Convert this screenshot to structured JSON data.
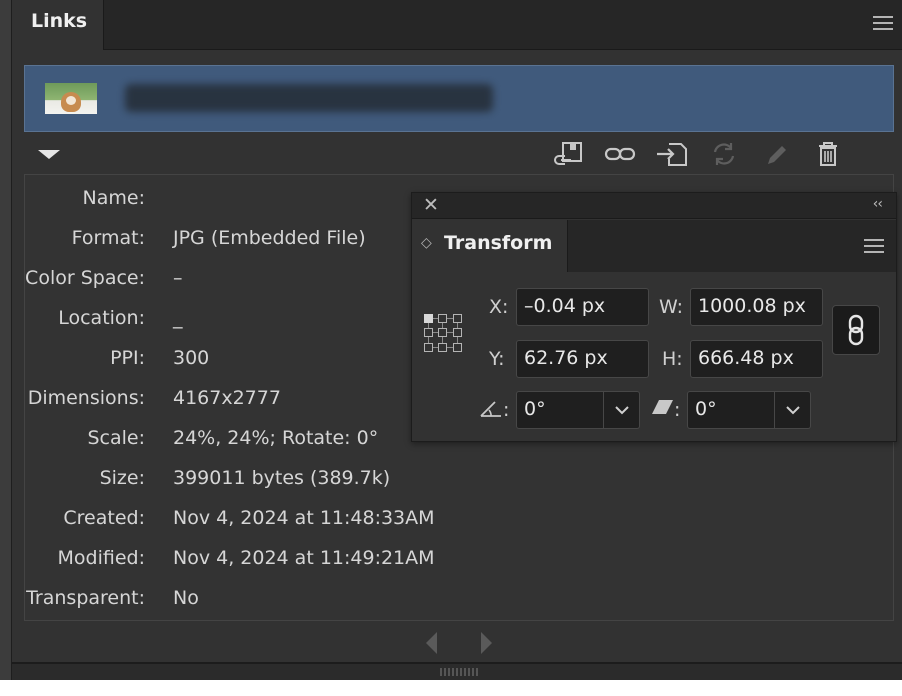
{
  "links_panel": {
    "tab_title": "Links",
    "menu_icon": "hamburger-menu-icon",
    "selected_link": {
      "name_redacted": true
    },
    "toolbar": {
      "icons": [
        "relink-from-cc-icon",
        "go-to-link-icon",
        "embed-icon",
        "update-link-icon",
        "edit-original-icon",
        "delete-icon"
      ]
    },
    "info": [
      {
        "label": "Name:",
        "value": ""
      },
      {
        "label": "Format:",
        "value": "JPG (Embedded File)"
      },
      {
        "label": "Color Space:",
        "value": "–"
      },
      {
        "label": "Location:",
        "value": "_"
      },
      {
        "label": "PPI:",
        "value": "300"
      },
      {
        "label": "Dimensions:",
        "value": "4167x2777"
      },
      {
        "label": "Scale:",
        "value": "24%, 24%; Rotate: 0°"
      },
      {
        "label": "Size:",
        "value": "399011 bytes (389.7k)"
      },
      {
        "label": "Created:",
        "value": "Nov 4, 2024 at 11:48:33AM"
      },
      {
        "label": "Modified:",
        "value": "Nov 4, 2024 at 11:49:21AM"
      },
      {
        "label": "Transparent:",
        "value": "No"
      }
    ]
  },
  "transform_panel": {
    "close_glyph": "✕",
    "collapse_glyph": "‹‹",
    "tab_glyph": "◇",
    "tab_title": "Transform",
    "x_label": "X:",
    "x_value": "–0.04 px",
    "y_label": "Y:",
    "y_value": "62.76 px",
    "w_label": "W:",
    "w_value": "1000.08 px",
    "h_label": "H:",
    "h_value": "666.48 px",
    "rotate_label": ":",
    "rotate_value": "0°",
    "shear_label": ":",
    "shear_value": "0°",
    "constrain_icon": "link-chain-icon"
  },
  "colors": {
    "panel_bg": "#323232",
    "selection": "#405a7c",
    "field_bg": "#1f1f1f"
  }
}
